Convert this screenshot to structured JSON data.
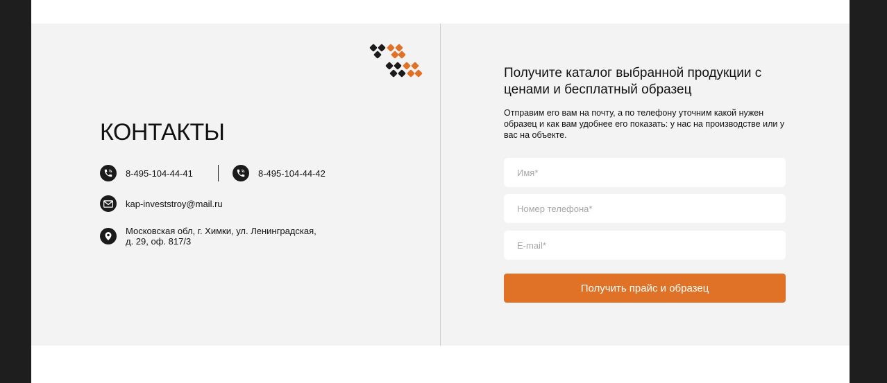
{
  "contacts": {
    "title": "КОНТАКТЫ",
    "phones": [
      "8-495-104-44-41",
      "8-495-104-44-42"
    ],
    "email": "kap-investstroy@mail.ru",
    "address_line1": "Московская обл, г. Химки, ул. Ленинградская,",
    "address_line2": "д. 29, оф. 817/3"
  },
  "form": {
    "heading": "Получите каталог выбранной продукции с ценами и бесплатный образец",
    "description": "Отправим его вам на почту, а по телефону уточним какой нужен образец и как вам удобнее его показать: у нас на производстве или у вас на объекте.",
    "name_placeholder": "Имя*",
    "phone_placeholder": "Номер телефона*",
    "email_placeholder": "E-mail*",
    "submit_label": "Получить прайс и образец"
  },
  "colors": {
    "accent": "#e07227",
    "dark": "#1b1b1b",
    "panel": "#f3f3f3"
  },
  "icons": [
    "logo-diamonds-icon",
    "phone-icon",
    "mail-icon",
    "location-pin-icon"
  ]
}
